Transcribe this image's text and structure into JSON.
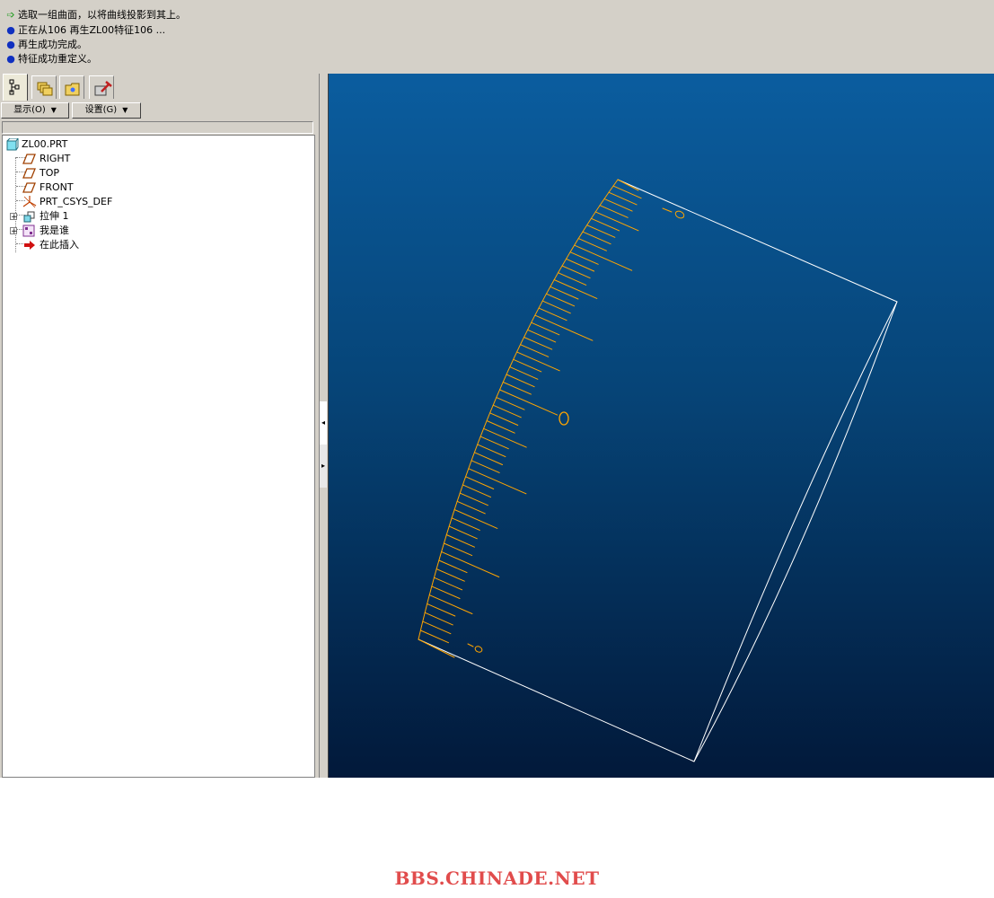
{
  "messages": [
    {
      "icon": "green-arrow-icon",
      "text": "选取一组曲面，以将曲线投影到其上。"
    },
    {
      "icon": "blue-dot-icon",
      "text": "正在从106 再生ZL00特征106 ..."
    },
    {
      "icon": "blue-dot-icon",
      "text": "再生成功完成。"
    },
    {
      "icon": "blue-dot-icon",
      "text": "特征成功重定义。"
    }
  ],
  "panel_tabs": [
    {
      "icon": "model-tree-icon",
      "active": true
    },
    {
      "icon": "layers-icon"
    },
    {
      "icon": "folder-browser-icon"
    },
    {
      "icon": "tools-hammer-icon"
    }
  ],
  "toolbar": {
    "show_label": "显示(O)",
    "settings_label": "设置(G)"
  },
  "tree": {
    "root": "ZL00.PRT",
    "items": [
      {
        "label": "RIGHT",
        "icon": "datum-plane-icon"
      },
      {
        "label": "TOP",
        "icon": "datum-plane-icon"
      },
      {
        "label": "FRONT",
        "icon": "datum-plane-icon"
      },
      {
        "label": "PRT_CSYS_DEF",
        "icon": "coordinate-system-icon"
      },
      {
        "label": "拉伸 1",
        "icon": "extrude-icon",
        "expandable": true
      },
      {
        "label": "我是谁",
        "icon": "group-icon",
        "expandable": true
      },
      {
        "label": "在此插入",
        "icon": "insert-here-arrow-icon"
      }
    ]
  },
  "colors": {
    "ui_gray": "#d4d0c8",
    "viewport_top": "#0b5d9f",
    "viewport_bottom": "#02193a",
    "edge_white": "#ffffff",
    "curve_orange": "#ffa500",
    "watermark": "#e14c4c"
  },
  "watermark": "BBS.CHINADE.NET"
}
